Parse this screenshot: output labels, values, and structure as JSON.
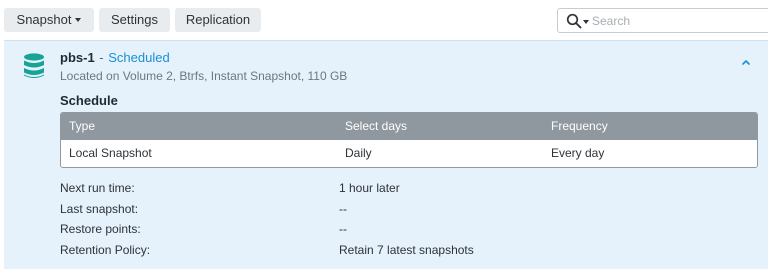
{
  "toolbar": {
    "snapshot_label": "Snapshot",
    "settings_label": "Settings",
    "replication_label": "Replication",
    "search_placeholder": "Search"
  },
  "panel": {
    "name": "pbs-1",
    "separator": "-",
    "status": "Scheduled",
    "status_color": "#1a8fd6",
    "subtitle": "Located on Volume 2, Btrfs, Instant Snapshot, 110 GB",
    "icon": "database-icon",
    "icon_color": "#17a398",
    "section_title": "Schedule",
    "table": {
      "columns": [
        "Type",
        "Select days",
        "Frequency"
      ],
      "rows": [
        [
          "Local Snapshot",
          "Daily",
          "Every day"
        ]
      ]
    },
    "details": [
      {
        "label": "Next run time:",
        "value": "1 hour later"
      },
      {
        "label": "Last snapshot:",
        "value": "--"
      },
      {
        "label": "Restore points:",
        "value": "--"
      },
      {
        "label": "Retention Policy:",
        "value": "Retain 7 latest snapshots"
      }
    ]
  }
}
